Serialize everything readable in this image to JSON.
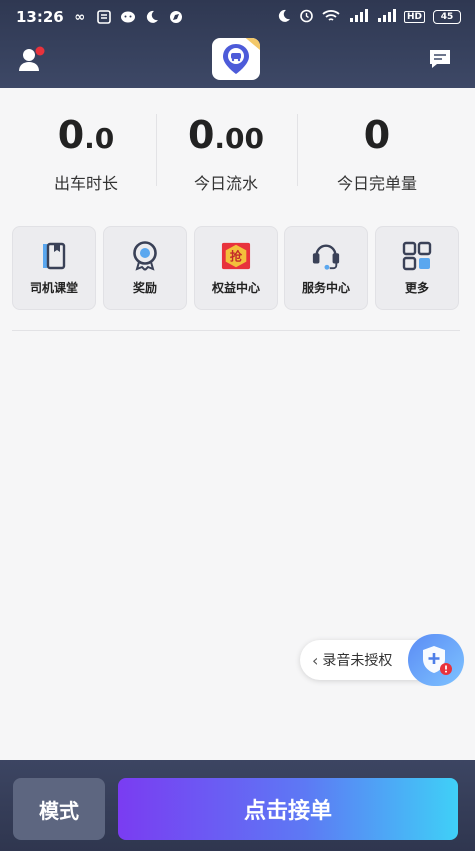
{
  "status_bar": {
    "time": "13:26",
    "battery": "45",
    "signal_1": "4G",
    "signal_2": "4G",
    "hd": "HD"
  },
  "app_bar": {
    "user_icon": "user-notification-icon",
    "logo_icon": "driver-app-logo-icon",
    "message_icon": "message-icon"
  },
  "stats": [
    {
      "value_int": "0",
      "value_dec": ".0",
      "label": "出车时长"
    },
    {
      "value_int": "0",
      "value_dec": ".00",
      "label": "今日流水"
    },
    {
      "value_int": "0",
      "value_dec": "",
      "label": "今日完单量"
    }
  ],
  "menu": [
    {
      "label": "司机课堂",
      "icon": "book-icon"
    },
    {
      "label": "奖励",
      "icon": "reward-medal-icon"
    },
    {
      "label": "权益中心",
      "icon": "grab-badge-icon",
      "badge_text": "抢"
    },
    {
      "label": "服务中心",
      "icon": "headset-icon"
    },
    {
      "label": "更多",
      "icon": "grid-icon"
    }
  ],
  "recording": {
    "label": "录音未授权",
    "icon": "shield-plus-icon"
  },
  "bottom": {
    "mode_label": "模式",
    "accept_label": "点击接单"
  },
  "colors": {
    "header_bg": "#2f3852",
    "accent_gradient_start": "#7a3cf2",
    "accent_gradient_end": "#3fd0f7",
    "badge_red": "#e8323c"
  }
}
